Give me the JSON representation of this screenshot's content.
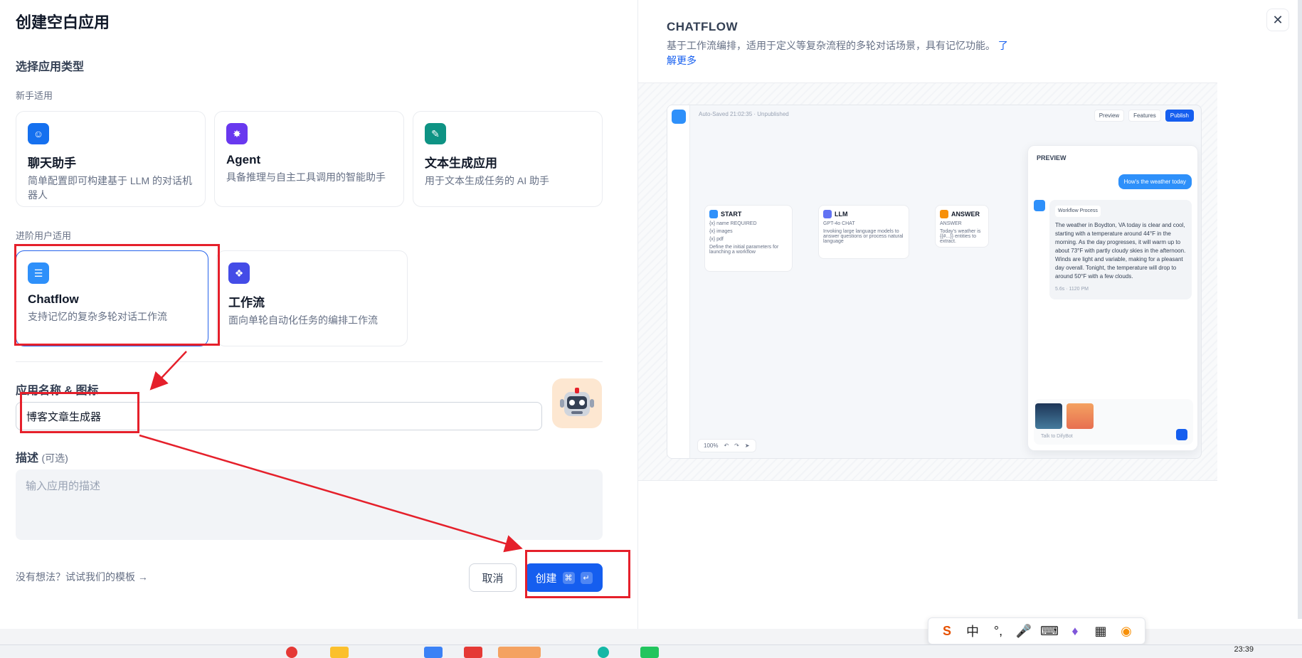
{
  "dialog": {
    "title": "创建空白应用",
    "section_type": "选择应用类型",
    "group_beginner": "新手适用",
    "group_advanced": "进阶用户适用",
    "cards_beginner": [
      {
        "title": "聊天助手",
        "desc": "简单配置即可构建基于 LLM 的对话机器人",
        "icon": "chat-bot-icon",
        "color": "#1570ef"
      },
      {
        "title": "Agent",
        "desc": "具备推理与自主工具调用的智能助手",
        "icon": "agent-icon",
        "color": "#6938ef"
      },
      {
        "title": "文本生成应用",
        "desc": "用于文本生成任务的 AI 助手",
        "icon": "text-generation-icon",
        "color": "#0e9384"
      }
    ],
    "cards_advanced": [
      {
        "title": "Chatflow",
        "desc": "支持记忆的复杂多轮对话工作流",
        "icon": "chatflow-icon",
        "color": "#2e90fa",
        "selected": true
      },
      {
        "title": "工作流",
        "desc": "面向单轮自动化任务的编排工作流",
        "icon": "workflow-icon",
        "color": "#444ce7"
      }
    ],
    "name_label": "应用名称 & 图标",
    "name_value": "博客文章生成器",
    "desc_label": "描述",
    "desc_optional": "(可选)",
    "desc_placeholder": "输入应用的描述",
    "template_link": "没有想法？试试我们的模板 →",
    "cancel_label": "取消",
    "create_label": "创建",
    "create_kbd": [
      "⌘",
      "↵"
    ]
  },
  "preview": {
    "title": "CHATFLOW",
    "desc": "基于工作流编排，适用于定义等复杂流程的多轮对话场景，具有记忆功能。",
    "learn_more": "了解更多",
    "mock": {
      "autosave": "Auto-Saved 21:02:35 · Unpublished",
      "toolbar": [
        "Preview",
        "Features",
        "Publish"
      ],
      "nodes": [
        {
          "title": "START",
          "rows": [
            "{x} name   REQUIRED",
            "{x} images",
            "{x} pdf",
            "Define the initial parameters for launching a workflow"
          ]
        },
        {
          "title": "LLM",
          "rows": [
            "GPT-4o   CHAT",
            "Invoking large language models to answer questions or process natural language"
          ]
        },
        {
          "title": "ANSWER",
          "rows": [
            "ANSWER",
            "Today's weather is {{#...}} entities to extract."
          ]
        }
      ],
      "chat_title": "PREVIEW",
      "user_msg": "How's the weather today",
      "workflow_tag": "Workflow Process",
      "bot_msg": "The weather in Boydton, VA today is clear and cool, starting with a temperature around 44°F in the morning. As the day progresses, it will warm up to about 73°F with partly cloudy skies in the afternoon. Winds are light and variable, making for a pleasant day overall. Tonight, the temperature will drop to around 50°F with a few clouds.",
      "bot_meta": "5.6s · 1120 PM",
      "input_placeholder": "Talk to DifyBot",
      "zoom": "100%"
    }
  },
  "ime": {
    "items": [
      "S",
      "中",
      "°,",
      "mic",
      "kbd",
      "shirt",
      "grid",
      "mascot"
    ]
  },
  "taskbar": {
    "time": "23:39"
  },
  "accent_color": "#155eef",
  "annotation_color": "#e5202b"
}
